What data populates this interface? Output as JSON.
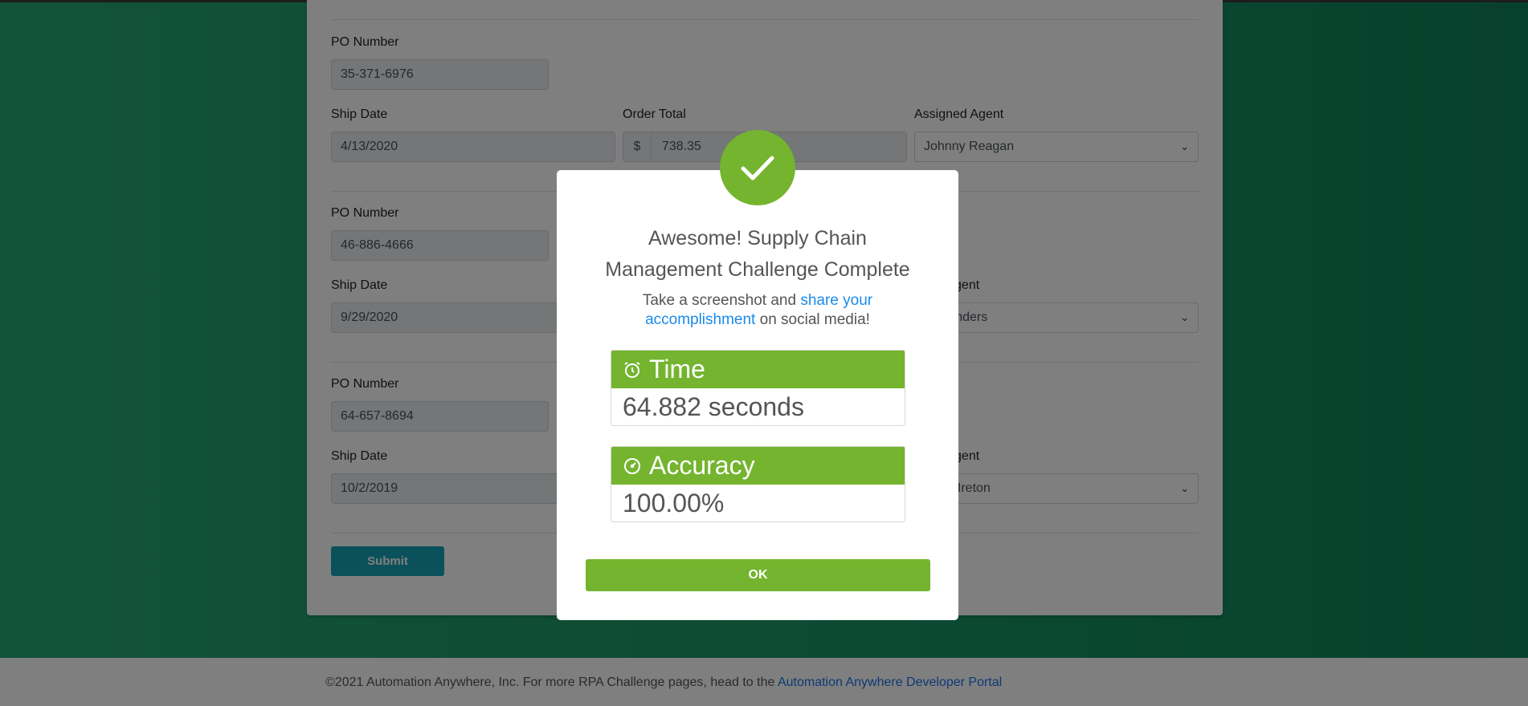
{
  "form": {
    "rows": [
      {
        "po_label": "PO Number",
        "po_value": "35-371-6976",
        "ship_label": "Ship Date",
        "ship_value": "4/13/2020",
        "total_label": "Order Total",
        "currency": "$",
        "total_value": "738.35",
        "agent_label": "Assigned Agent",
        "agent_value": "Johnny Reagan"
      },
      {
        "po_label": "PO Number",
        "po_value": "46-886-4666",
        "ship_label": "Ship Date",
        "ship_value": "9/29/2020",
        "agent_label": "ed Agent",
        "agent_value": "Manders"
      },
      {
        "po_label": "PO Number",
        "po_value": "64-657-8694",
        "ship_label": "Ship Date",
        "ship_value": "10/2/2019",
        "agent_label": "ed Agent",
        "agent_value": "ew Ireton"
      }
    ],
    "submit_label": "Submit"
  },
  "footer": {
    "text": "©2021 Automation Anywhere, Inc. For more RPA Challenge pages, head to the ",
    "link": "Automation Anywhere Developer Portal"
  },
  "modal": {
    "title_line1": "Awesome! Supply Chain",
    "title_line2": "Management Challenge Complete",
    "sub_pre": "Take a screenshot and ",
    "sub_link": "share your accomplishment",
    "sub_post": " on social media!",
    "time_label": "Time",
    "time_value": "64.882 seconds",
    "accuracy_label": "Accuracy",
    "accuracy_value": "100.00%",
    "ok_label": "OK",
    "icons": {
      "header": "checkmark-icon",
      "time": "alarm-clock-icon",
      "accuracy": "speedometer-icon"
    }
  },
  "colors": {
    "accent": "#74b42f",
    "link": "#1a8bea",
    "submit": "#17a2b8"
  }
}
